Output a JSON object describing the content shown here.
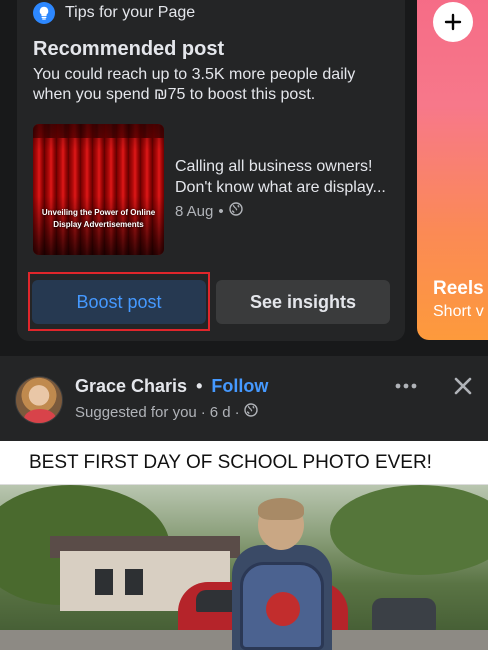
{
  "tips": {
    "header": "Tips for your Page",
    "title": "Recommended post",
    "description": "You could reach up to 3.5K more people daily when you spend ₪75 to boost this post."
  },
  "promoted_post": {
    "thumbnail_text": "Unveiling the Power of Online Display Advertisements",
    "line1": "Calling all business owners!",
    "line2": "Don't know what are display...",
    "date": "8 Aug",
    "separator": "•"
  },
  "actions": {
    "boost_label": "Boost post",
    "insights_label": "See insights"
  },
  "reels": {
    "title": "Reels",
    "subtitle": "Short v"
  },
  "post": {
    "author": "Grace Charis",
    "separator": "•",
    "follow_label": "Follow",
    "suggested": "Suggested for you",
    "time": "6 d",
    "time_sep": "·",
    "meme_caption": "BEST FIRST DAY OF SCHOOL PHOTO EVER!"
  },
  "colors": {
    "accent": "#4599ff",
    "highlight_box": "#e0262b",
    "card_bg": "#242526"
  },
  "icons": {
    "tips": "lightbulb-icon",
    "audience": "globe-icon",
    "add": "plus-icon",
    "menu": "more-horizontal-icon",
    "dismiss": "close-icon"
  }
}
